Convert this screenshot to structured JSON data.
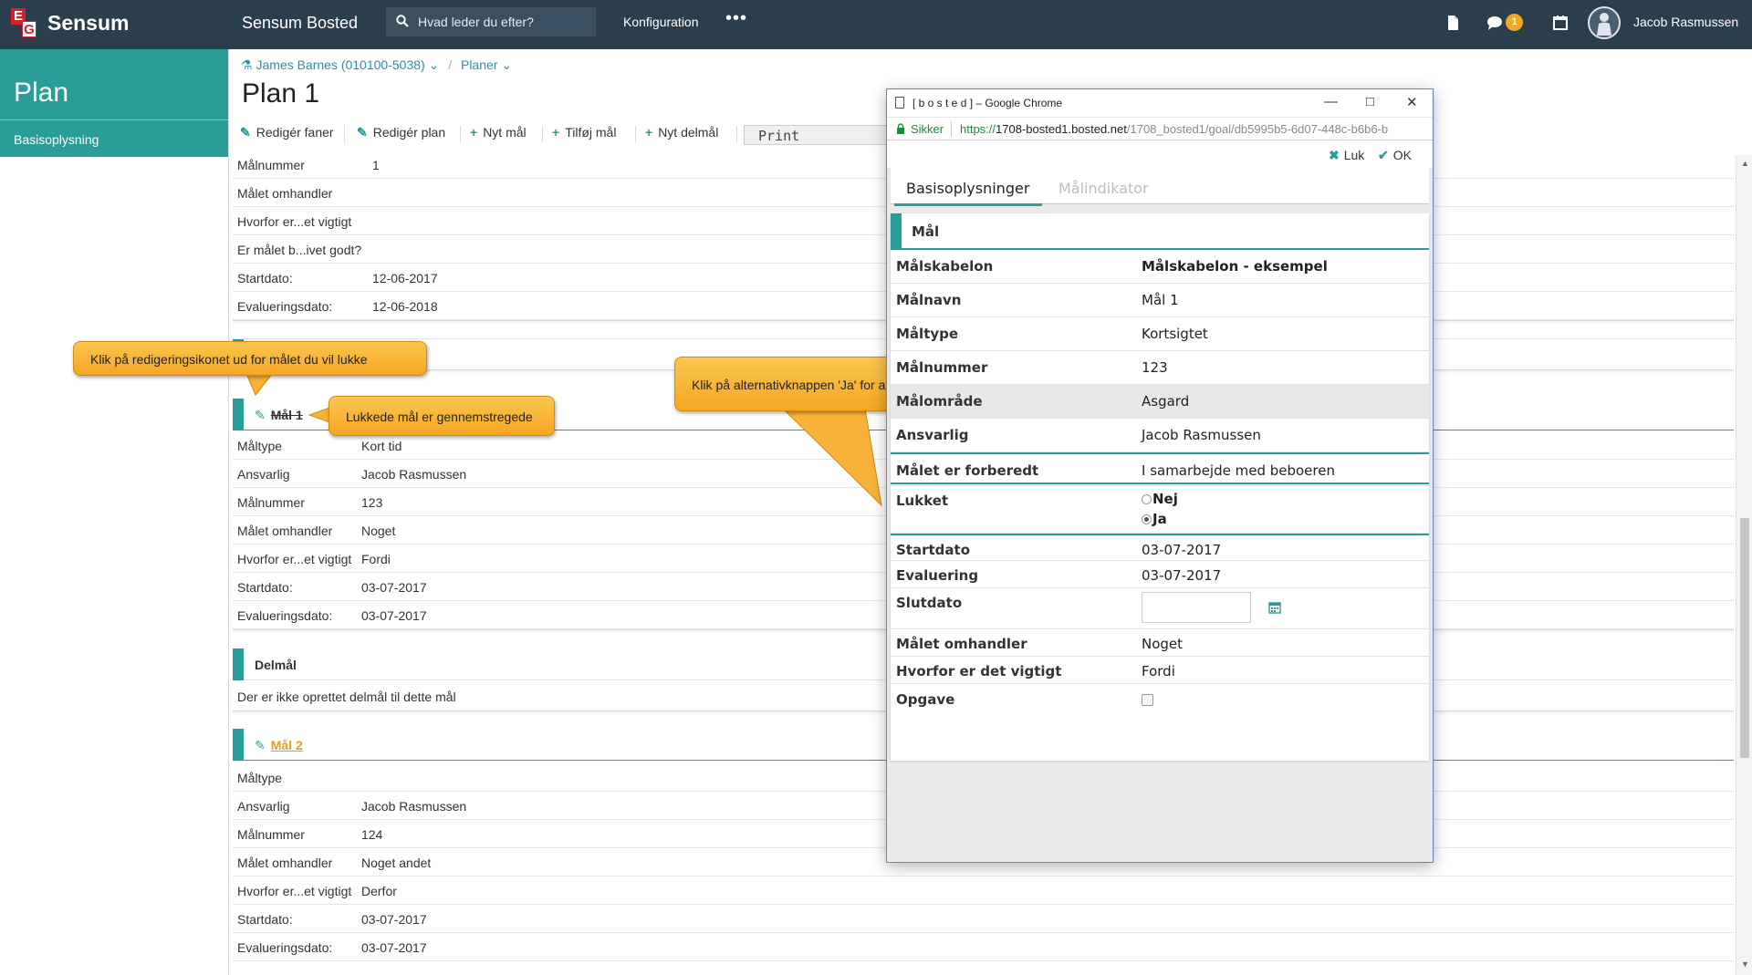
{
  "topbar": {
    "brand": "Sensum",
    "logo_letters": [
      "E",
      "G"
    ],
    "app_title": "Sensum Bosted",
    "search_placeholder": "Hvad leder du efter?",
    "config_label": "Konfiguration",
    "more_label": "•••",
    "message_count": "1",
    "user_name": "Jacob Rasmussen"
  },
  "sidebar": {
    "title": "Plan",
    "items": [
      {
        "label": "Basisoplysning"
      }
    ]
  },
  "breadcrumb": {
    "person": "James Barnes (010100-5038)",
    "section": "Planer"
  },
  "page_title": "Plan 1",
  "toolbar": {
    "edit_tabs": "Redigér faner",
    "edit_plan": "Redigér plan",
    "new_goal": "Nyt mål",
    "add_goal": "Tilføj mål",
    "new_subgoal": "Nyt delmål",
    "print": "Print"
  },
  "plan_details": [
    {
      "label": "Målnummer",
      "value": "1"
    },
    {
      "label": "Målet omhandler",
      "value": ""
    },
    {
      "label": "Hvorfor er...et vigtigt",
      "value": ""
    },
    {
      "label": "Er målet b...ivet godt?",
      "value": ""
    },
    {
      "label": "Startdato:",
      "value": "12-06-2017"
    },
    {
      "label": "Evalueringsdato:",
      "value": "12-06-2018"
    }
  ],
  "goal1": {
    "title": "Mål 1",
    "rows": [
      {
        "label": "Måltype",
        "value": "Kort tid"
      },
      {
        "label": "Ansvarlig",
        "value": "Jacob Rasmussen"
      },
      {
        "label": "Målnummer",
        "value": "123"
      },
      {
        "label": "Målet omhandler",
        "value": "Noget"
      },
      {
        "label": "Hvorfor er...et vigtigt",
        "value": "Fordi"
      },
      {
        "label": "Startdato:",
        "value": "03-07-2017"
      },
      {
        "label": "Evalueringsdato:",
        "value": "03-07-2017"
      }
    ]
  },
  "subgoals": {
    "title": "Delmål",
    "empty_text": "Der er ikke oprettet delmål til dette mål"
  },
  "goal2": {
    "title": "Mål 2",
    "rows": [
      {
        "label": "Måltype",
        "value": ""
      },
      {
        "label": "Ansvarlig",
        "value": "Jacob Rasmussen"
      },
      {
        "label": "Målnummer",
        "value": "124"
      },
      {
        "label": "Målet omhandler",
        "value": "Noget andet"
      },
      {
        "label": "Hvorfor er...et vigtigt",
        "value": "Derfor"
      },
      {
        "label": "Startdato:",
        "value": "03-07-2017"
      },
      {
        "label": "Evalueringsdato:",
        "value": "03-07-2017"
      }
    ]
  },
  "callouts": {
    "edit_icon_tip": "Klik på redigeringsikonet ud for målet du vil lukke",
    "struck_tip": "Lukkede mål er gennemstregede",
    "radio_tip": "Klik på alternativknappen 'Ja' for at lukke målet"
  },
  "popup": {
    "window_title": "[ b o s t e d ] – Google Chrome",
    "secure_label": "Sikker",
    "url_scheme": "https://",
    "url_host": "1708-bosted1.bosted.net",
    "url_path": "/1708_bosted1/goal/db5995b5-6d07-448c-b6b6-b",
    "close_label": "Luk",
    "ok_label": "OK",
    "tab_active": "Basisoplysninger",
    "tab_inactive": "Målindikator",
    "section_title": "Mål",
    "rows": [
      {
        "label": "Målskabelon",
        "value": "Målskabelon - eksempel"
      },
      {
        "label": "Målnavn",
        "value": "Mål 1"
      },
      {
        "label": "Måltype",
        "value": "Kortsigtet"
      },
      {
        "label": "Målnummer",
        "value": "123"
      },
      {
        "label": "Målområde",
        "value": "Asgard"
      },
      {
        "label": "Ansvarlig",
        "value": "Jacob Rasmussen"
      },
      {
        "label": "Målet er forberedt",
        "value": "I samarbejde med beboeren"
      }
    ],
    "lukket_label": "Lukket",
    "radio_no": "Nej",
    "radio_yes": "Ja",
    "startdato_label": "Startdato",
    "startdato_value": "03-07-2017",
    "evaluering_label": "Evaluering",
    "evaluering_value": "03-07-2017",
    "slutdato_label": "Slutdato",
    "omhandler_label": "Målet omhandler",
    "omhandler_value": "Noget",
    "hvorfor_label": "Hvorfor er det vigtigt",
    "hvorfor_value": "Fordi",
    "opgave_label": "Opgave"
  },
  "colors": {
    "topbar": "#2b3e4c",
    "accent": "#2a9d98",
    "callout": "#f5a623",
    "link": "#e2a01e"
  }
}
